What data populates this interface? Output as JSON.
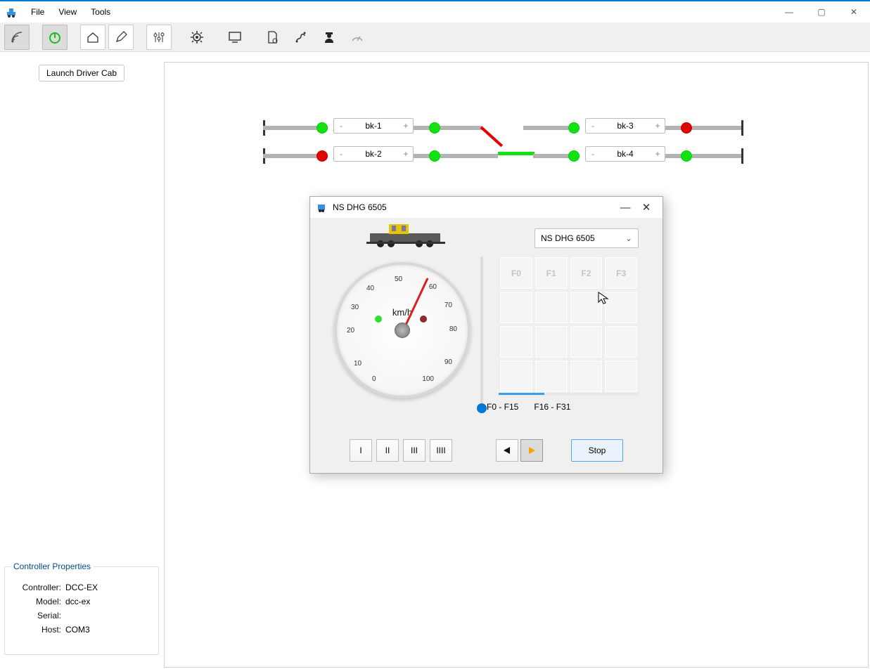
{
  "menu": {
    "file": "File",
    "view": "View",
    "tools": "Tools"
  },
  "toolbar": {
    "launch_cab": "Launch Driver Cab"
  },
  "blocks": {
    "bk1": "bk-1",
    "bk2": "bk-2",
    "bk3": "bk-3",
    "bk4": "bk-4"
  },
  "cab": {
    "title": "NS DHG 6505",
    "selected_loco": "NS DHG 6505",
    "unit": "km/h",
    "ticks": {
      "t0": "0",
      "t10": "10",
      "t20": "20",
      "t30": "30",
      "t40": "40",
      "t50": "50",
      "t60": "60",
      "t70": "70",
      "t80": "80",
      "t90": "90",
      "t100": "100"
    },
    "f": {
      "f0": "F0",
      "f1": "F1",
      "f2": "F2",
      "f3": "F3"
    },
    "tab1": "F0 - F15",
    "tab2": "F16 - F31",
    "steps": {
      "s1": "I",
      "s2": "II",
      "s3": "III",
      "s4": "IIII"
    },
    "stop": "Stop"
  },
  "props": {
    "legend": "Controller Properties",
    "l_controller": "Controller:",
    "v_controller": "DCC-EX",
    "l_model": "Model:",
    "v_model": "dcc-ex",
    "l_serial": "Serial:",
    "v_serial": "",
    "l_host": "Host:",
    "v_host": "COM3"
  }
}
